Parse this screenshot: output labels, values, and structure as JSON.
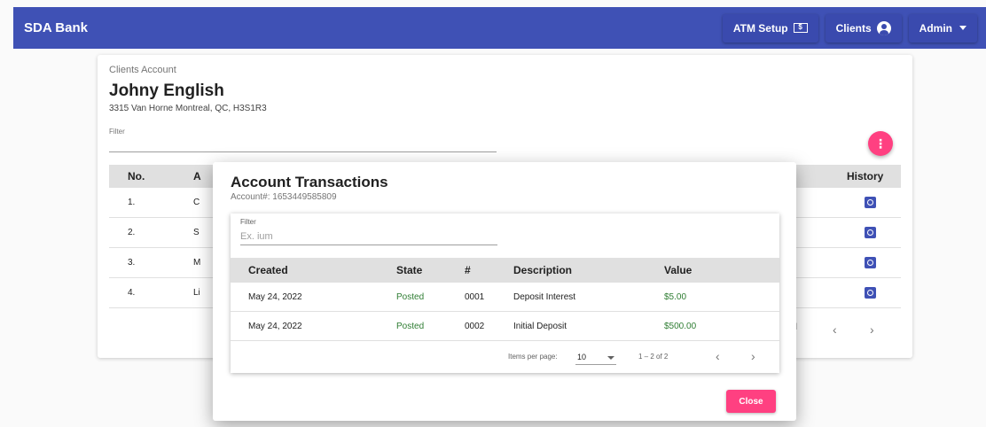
{
  "topbar": {
    "brand": "SDA Bank",
    "atm_setup": "ATM Setup",
    "atm_icon_glyph": "$",
    "clients": "Clients",
    "admin": "Admin"
  },
  "clients_card": {
    "subtitle": "Clients Account",
    "name": "Johny English",
    "address": "3315 Van Horne Montreal, QC, H3S1R3",
    "filter_label": "Filter",
    "fab_glyph": "⋮",
    "columns": {
      "no": "No.",
      "account": "A",
      "history": "History"
    },
    "rows": [
      {
        "no": "1.",
        "account": "C"
      },
      {
        "no": "2.",
        "account": "S"
      },
      {
        "no": "3.",
        "account": "M"
      },
      {
        "no": "4.",
        "account": "Li"
      }
    ],
    "pagination": {
      "mark": "l",
      "prev": "‹",
      "next": "›"
    }
  },
  "dialog": {
    "title": "Account Transactions",
    "account_line": "Account#: 1653449585809",
    "filter_label": "Filter",
    "filter_placeholder": "Ex. ium",
    "filter_value": "",
    "columns": {
      "created": "Created",
      "state": "State",
      "num": "#",
      "description": "Description",
      "value": "Value"
    },
    "transactions": [
      {
        "created": "May 24, 2022",
        "state": "Posted",
        "num": "0001",
        "description": "Deposit Interest",
        "value": "$5.00"
      },
      {
        "created": "May 24, 2022",
        "state": "Posted",
        "num": "0002",
        "description": "Initial Deposit",
        "value": "$500.00"
      }
    ],
    "pagination": {
      "items_per_page_label": "Items per page:",
      "page_size": "10",
      "range": "1 – 2 of 2",
      "prev": "‹",
      "next": "›"
    },
    "close_label": "Close"
  },
  "colors": {
    "primary": "#3f51b5",
    "accent": "#ff4081",
    "posted": "#2e7d32"
  }
}
